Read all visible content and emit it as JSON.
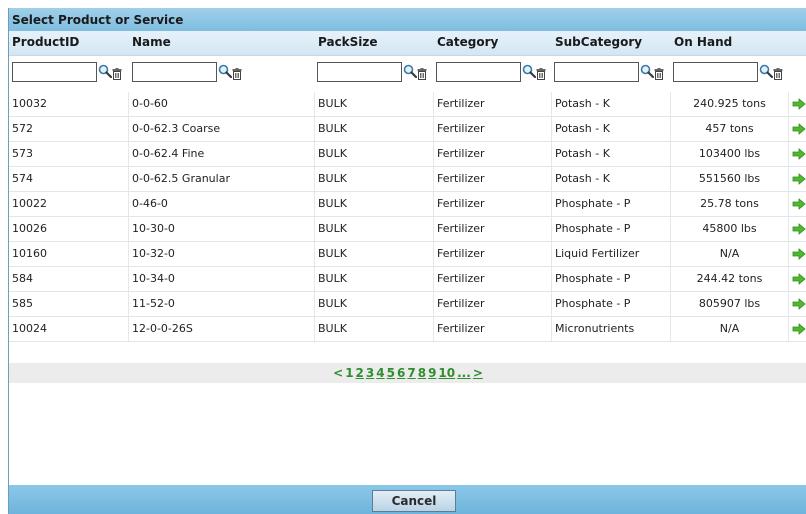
{
  "dialog": {
    "title": "Select Product or Service",
    "columns": [
      "ProductID",
      "Name",
      "PackSize",
      "Category",
      "SubCategory",
      "On Hand"
    ],
    "rows": [
      {
        "id": "10032",
        "name": "0-0-60",
        "pack": "BULK",
        "category": "Fertilizer",
        "sub": "Potash - K",
        "onhand": "240.925 tons"
      },
      {
        "id": "572",
        "name": "0-0-62.3 Coarse",
        "pack": "BULK",
        "category": "Fertilizer",
        "sub": "Potash - K",
        "onhand": "457 tons"
      },
      {
        "id": "573",
        "name": "0-0-62.4 Fine",
        "pack": "BULK",
        "category": "Fertilizer",
        "sub": "Potash - K",
        "onhand": "103400 lbs"
      },
      {
        "id": "574",
        "name": "0-0-62.5 Granular",
        "pack": "BULK",
        "category": "Fertilizer",
        "sub": "Potash - K",
        "onhand": "551560 lbs"
      },
      {
        "id": "10022",
        "name": "0-46-0",
        "pack": "BULK",
        "category": "Fertilizer",
        "sub": "Phosphate - P",
        "onhand": "25.78 tons"
      },
      {
        "id": "10026",
        "name": "10-30-0",
        "pack": "BULK",
        "category": "Fertilizer",
        "sub": "Phosphate - P",
        "onhand": "45800 lbs"
      },
      {
        "id": "10160",
        "name": "10-32-0",
        "pack": "BULK",
        "category": "Fertilizer",
        "sub": "Liquid Fertilizer",
        "onhand": "N/A"
      },
      {
        "id": "584",
        "name": "10-34-0",
        "pack": "BULK",
        "category": "Fertilizer",
        "sub": "Phosphate - P",
        "onhand": "244.42 tons"
      },
      {
        "id": "585",
        "name": "11-52-0",
        "pack": "BULK",
        "category": "Fertilizer",
        "sub": "Phosphate - P",
        "onhand": "805907 lbs"
      },
      {
        "id": "10024",
        "name": "12-0-0-26S",
        "pack": "BULK",
        "category": "Fertilizer",
        "sub": "Micronutrients",
        "onhand": "N/A"
      }
    ],
    "pager": [
      "<",
      "1",
      "2",
      "3",
      "4",
      "5",
      "6",
      "7",
      "8",
      "9",
      "10",
      "...",
      ">"
    ],
    "cancel_label": "Cancel"
  },
  "icons": {
    "filter_search": "magnifier-icon",
    "filter_clear": "trash-icon",
    "row_select": "green-arrow-icon"
  },
  "colors": {
    "title_bar": "#7fbde0",
    "pager_link": "#2f8f2f",
    "select_arrow": "#4fb82e"
  }
}
